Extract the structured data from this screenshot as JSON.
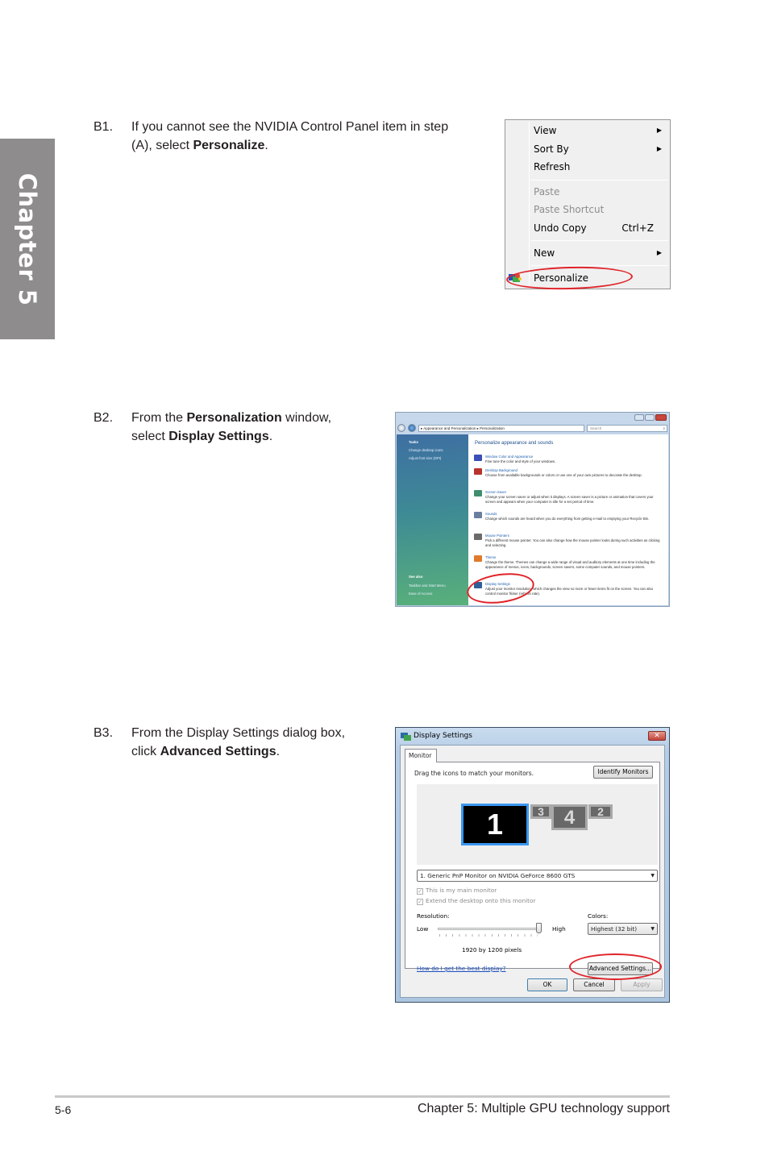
{
  "chapter_tab": "Chapter 5",
  "steps": [
    {
      "num": "B1.",
      "line1": "If you cannot see the NVIDIA Control Panel item in step",
      "line2_prefix": "(A), select ",
      "line2_bold": "Personalize",
      "line2_suffix": "."
    },
    {
      "num": "B2.",
      "line1_prefix": "From the ",
      "line1_bold": "Personalization",
      "line1_suffix": " window,",
      "line2_prefix": "select ",
      "line2_bold": "Display Settings",
      "line2_suffix": "."
    },
    {
      "num": "B3.",
      "line1": "From the Display Settings dialog box,",
      "line2_prefix": "click ",
      "line2_bold": "Advanced Settings",
      "line2_suffix": "."
    }
  ],
  "context_menu": {
    "items": [
      {
        "label": "View",
        "submenu": true,
        "disabled": false
      },
      {
        "label": "Sort By",
        "submenu": true,
        "disabled": false
      },
      {
        "label": "Refresh",
        "submenu": false,
        "disabled": false
      },
      {
        "label": "Paste",
        "submenu": false,
        "disabled": true
      },
      {
        "label": "Paste Shortcut",
        "submenu": false,
        "disabled": true
      },
      {
        "label": "Undo Copy",
        "shortcut": "Ctrl+Z",
        "submenu": false,
        "disabled": false
      },
      {
        "label": "New",
        "submenu": true,
        "disabled": false
      },
      {
        "label": "Personalize",
        "icon": "personalize-icon",
        "submenu": false,
        "disabled": false,
        "highlighted": true
      }
    ],
    "submenu_arrow": "▶"
  },
  "personalization_window": {
    "breadcrumb": [
      "Appearance and Personalization",
      "Personalization"
    ],
    "breadcrumb_sep": "▸",
    "search_placeholder": "Search",
    "search_icon": "⌕",
    "tasks_heading": "Tasks",
    "tasks": [
      "Change desktop icons",
      "Adjust font size (DPI)"
    ],
    "see_also_heading": "See also",
    "see_also": [
      "Taskbar and Start Menu",
      "Ease of Access"
    ],
    "main_title": "Personalize appearance and sounds",
    "items": [
      {
        "link": "Window Color and Appearance",
        "desc": "Fine tune the color and style of your windows.",
        "color": "#3b4fb8"
      },
      {
        "link": "Desktop Background",
        "desc": "Choose from available backgrounds or colors or use one of your own pictures to decorate the desktop.",
        "color": "#b8332c"
      },
      {
        "link": "Screen Saver",
        "desc": "Change your screen saver or adjust when it displays. A screen saver is a picture or animation that covers your screen and appears when your computer is idle for a set period of time.",
        "color": "#3f8f6e"
      },
      {
        "link": "Sounds",
        "desc": "Change which sounds are heard when you do everything from getting e-mail to emptying your Recycle Bin.",
        "color": "#6a7fa0"
      },
      {
        "link": "Mouse Pointers",
        "desc": "Pick a different mouse pointer. You can also change how the mouse pointer looks during such activities as clicking and selecting.",
        "color": "#6b6b6b"
      },
      {
        "link": "Theme",
        "desc": "Change the theme. Themes can change a wide range of visual and auditory elements at one time including the appearance of menus, icons, backgrounds, screen savers, some computer sounds, and mouse pointers.",
        "color": "#e07a2a"
      },
      {
        "link": "Display Settings",
        "desc": "Adjust your monitor resolution, which changes the view so more or fewer items fit on the screen. You can also control monitor flicker (refresh rate).",
        "color": "#2f5f9a",
        "highlighted": true
      }
    ]
  },
  "display_settings": {
    "title": "Display Settings",
    "close": "✕",
    "tab": "Monitor",
    "instruction": "Drag the icons to match your monitors.",
    "identify_button": "Identify Monitors",
    "monitors": [
      "1",
      "3",
      "4",
      "2"
    ],
    "selected_monitor": "1. Generic PnP Monitor on NVIDIA GeForce 8600 GTS",
    "checkboxes": [
      {
        "label": "This is my main monitor",
        "checked": true,
        "disabled": true
      },
      {
        "label": "Extend the desktop onto this monitor",
        "checked": true,
        "disabled": true
      }
    ],
    "resolution_label": "Resolution:",
    "low_label": "Low",
    "high_label": "High",
    "resolution_slider_fraction": 1.0,
    "resolution_value": "1920 by 1200 pixels",
    "colors_label": "Colors:",
    "colors_value": "Highest (32 bit)",
    "help_link": "How do I get the best display?",
    "advanced_button": "Advanced Settings...",
    "ok_button": "OK",
    "cancel_button": "Cancel",
    "apply_button": "Apply",
    "dropdown_arrow": "▼",
    "check_mark": "✓"
  },
  "footer": {
    "page_number": "5-6",
    "chapter_title": "Chapter 5: Multiple GPU technology support"
  },
  "highlight_color": "#e0242a"
}
